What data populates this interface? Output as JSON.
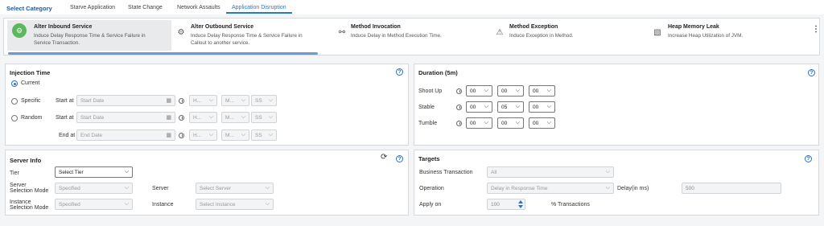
{
  "header": {
    "select_category": "Select Category",
    "tabs": [
      {
        "label": "Starve Application",
        "active": false
      },
      {
        "label": "State Change",
        "active": false
      },
      {
        "label": "Network Assaults",
        "active": false
      },
      {
        "label": "Application Disruption",
        "active": true
      }
    ]
  },
  "cards": [
    {
      "title": "Alter Inbound Service",
      "desc1": "Induce Delay Response Time & Service Failure in",
      "desc2": "Service Transaction.",
      "icon": "gear-icon",
      "selected": true
    },
    {
      "title": "Alter Outbound Service",
      "desc1": "Induce Delay Response Time & Service Failure in",
      "desc2": "Callout to another service.",
      "icon": "gear-outline-icon"
    },
    {
      "title": "Method Invocation",
      "desc1": "Induce Delay in Method Execution Time.",
      "desc2": "",
      "icon": "link-icon"
    },
    {
      "title": "Method Exception",
      "desc1": "Induce Exception in Method.",
      "desc2": "",
      "icon": "warning-icon"
    },
    {
      "title": "Heap Memory Leak",
      "desc1": "Increase Heap Utilization of JVM.",
      "desc2": "",
      "icon": "memory-icon"
    }
  ],
  "cards_progress": 0.38,
  "more_glyph": "⋮",
  "help_glyph": "?",
  "refresh_glyph": "⟳",
  "chev": "⌵",
  "cal_glyph": "▦",
  "injection": {
    "title": "Injection Time",
    "current": "Current",
    "specific": "Specific",
    "random": "Random",
    "start_at": "Start at",
    "end_at": "End at",
    "start_placeholder": "Start Date",
    "end_placeholder": "End Date",
    "hh": "H...",
    "mm": "M...",
    "ss": "SS"
  },
  "duration": {
    "title": "Duration (5m)",
    "rows": [
      {
        "label": "Shoot Up",
        "h": "00",
        "m": "00",
        "s": "00"
      },
      {
        "label": "Stable",
        "h": "00",
        "m": "05",
        "s": "00"
      },
      {
        "label": "Tumble",
        "h": "00",
        "m": "00",
        "s": "00"
      }
    ]
  },
  "server": {
    "title": "Server Info",
    "tier_label": "Tier",
    "tier_value": "Select Tier",
    "server_sel_label1": "Server",
    "server_sel_label2": "Selection Mode",
    "server_sel_value": "Specified",
    "server_label": "Server",
    "server_value": "Select Server",
    "inst_sel_label1": "Instance",
    "inst_sel_label2": "Selection Mode",
    "inst_sel_value": "Specified",
    "instance_label": "Instance",
    "instance_value": "Select Instance"
  },
  "targets": {
    "title": "Targets",
    "bt_label": "Business Transaction",
    "bt_value": "All",
    "op_label": "Operation",
    "op_value": "Delay in Response Time",
    "delay_label": "Delay(in ms)",
    "delay_value": "500",
    "apply_label": "Apply on",
    "apply_value": "100",
    "pct_label": "% Transactions"
  },
  "colors": {
    "accent": "#1f7ad1",
    "selected_icon": "#5cb85c"
  }
}
